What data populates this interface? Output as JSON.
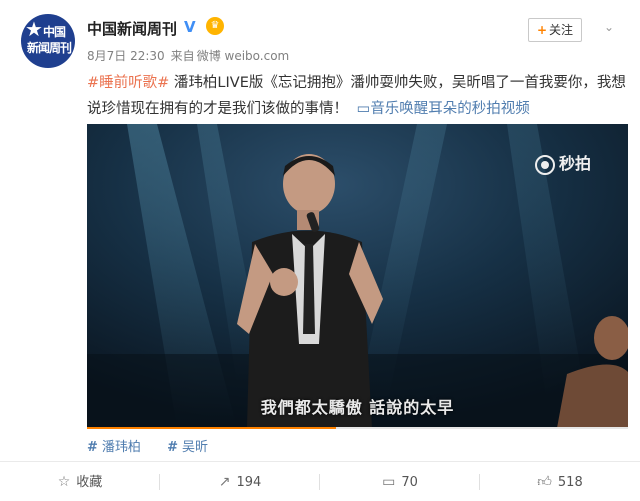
{
  "account": {
    "name": "中国新闻周刊",
    "avatar_line1": "中国",
    "avatar_line2": "新闻周刊",
    "verified_icon": "verified-badge-icon",
    "vip_icon": "vip-crown-icon",
    "date": "8月7日 22:30",
    "source_prefix": "来自",
    "source": "微博 weibo.com"
  },
  "follow": {
    "plus": "+",
    "label": "关注"
  },
  "post": {
    "hashtag": "#睡前听歌#",
    "text": " 潘玮柏LIVE版《忘记拥抱》潘帅耍帅失败，吴昕唱了一首我要你，我想说珍惜现在拥有的才是我们该做的事情！",
    "video_link": "音乐唤醒耳朵的秒拍视频"
  },
  "video": {
    "subtitle": "我們都太驕傲  話說的太早",
    "watermark": "秒拍",
    "progress": 0.46
  },
  "tags": [
    {
      "label": "潘玮柏"
    },
    {
      "label": "吴昕"
    }
  ],
  "actions": {
    "favorite": "收藏",
    "repost": "194",
    "comment": "70",
    "like": "518"
  },
  "colors": {
    "accent": "#ff8200",
    "link": "#507daf",
    "hashtag": "#eb7350"
  }
}
